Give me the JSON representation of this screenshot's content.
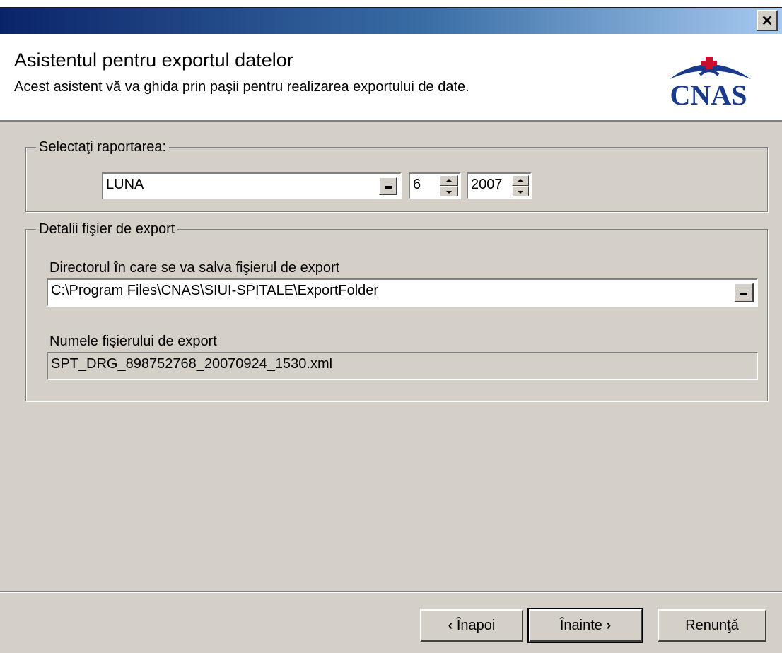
{
  "window": {
    "close_glyph": "✕"
  },
  "header": {
    "title": "Asistentul pentru exportul datelor",
    "subtitle": "Acest asistent vă va ghida prin paşii pentru realizarea exportului de date.",
    "logo_text": "CNAS"
  },
  "report_group": {
    "label": "Selectaţi raportarea:",
    "period_value": "LUNA",
    "month_value": "6",
    "year_value": "2007"
  },
  "export_group": {
    "label": "Detalii fişier de export",
    "dir_label": "Directorul în care se va salva fişierul de export",
    "dir_value": "C:\\Program Files\\CNAS\\SIUI-SPITALE\\ExportFolder",
    "file_label": "Numele fişierului de export",
    "file_value": "SPT_DRG_898752768_20070924_1530.xml"
  },
  "buttons": {
    "back": "Înapoi",
    "next": "Înainte",
    "cancel": "Renunţă"
  },
  "colors": {
    "titlebar_start": "#0a246a",
    "titlebar_end": "#a6caf0",
    "dialog_bg": "#d4d0c8",
    "logo_blue": "#1a3a8c",
    "logo_red": "#c8102e"
  }
}
